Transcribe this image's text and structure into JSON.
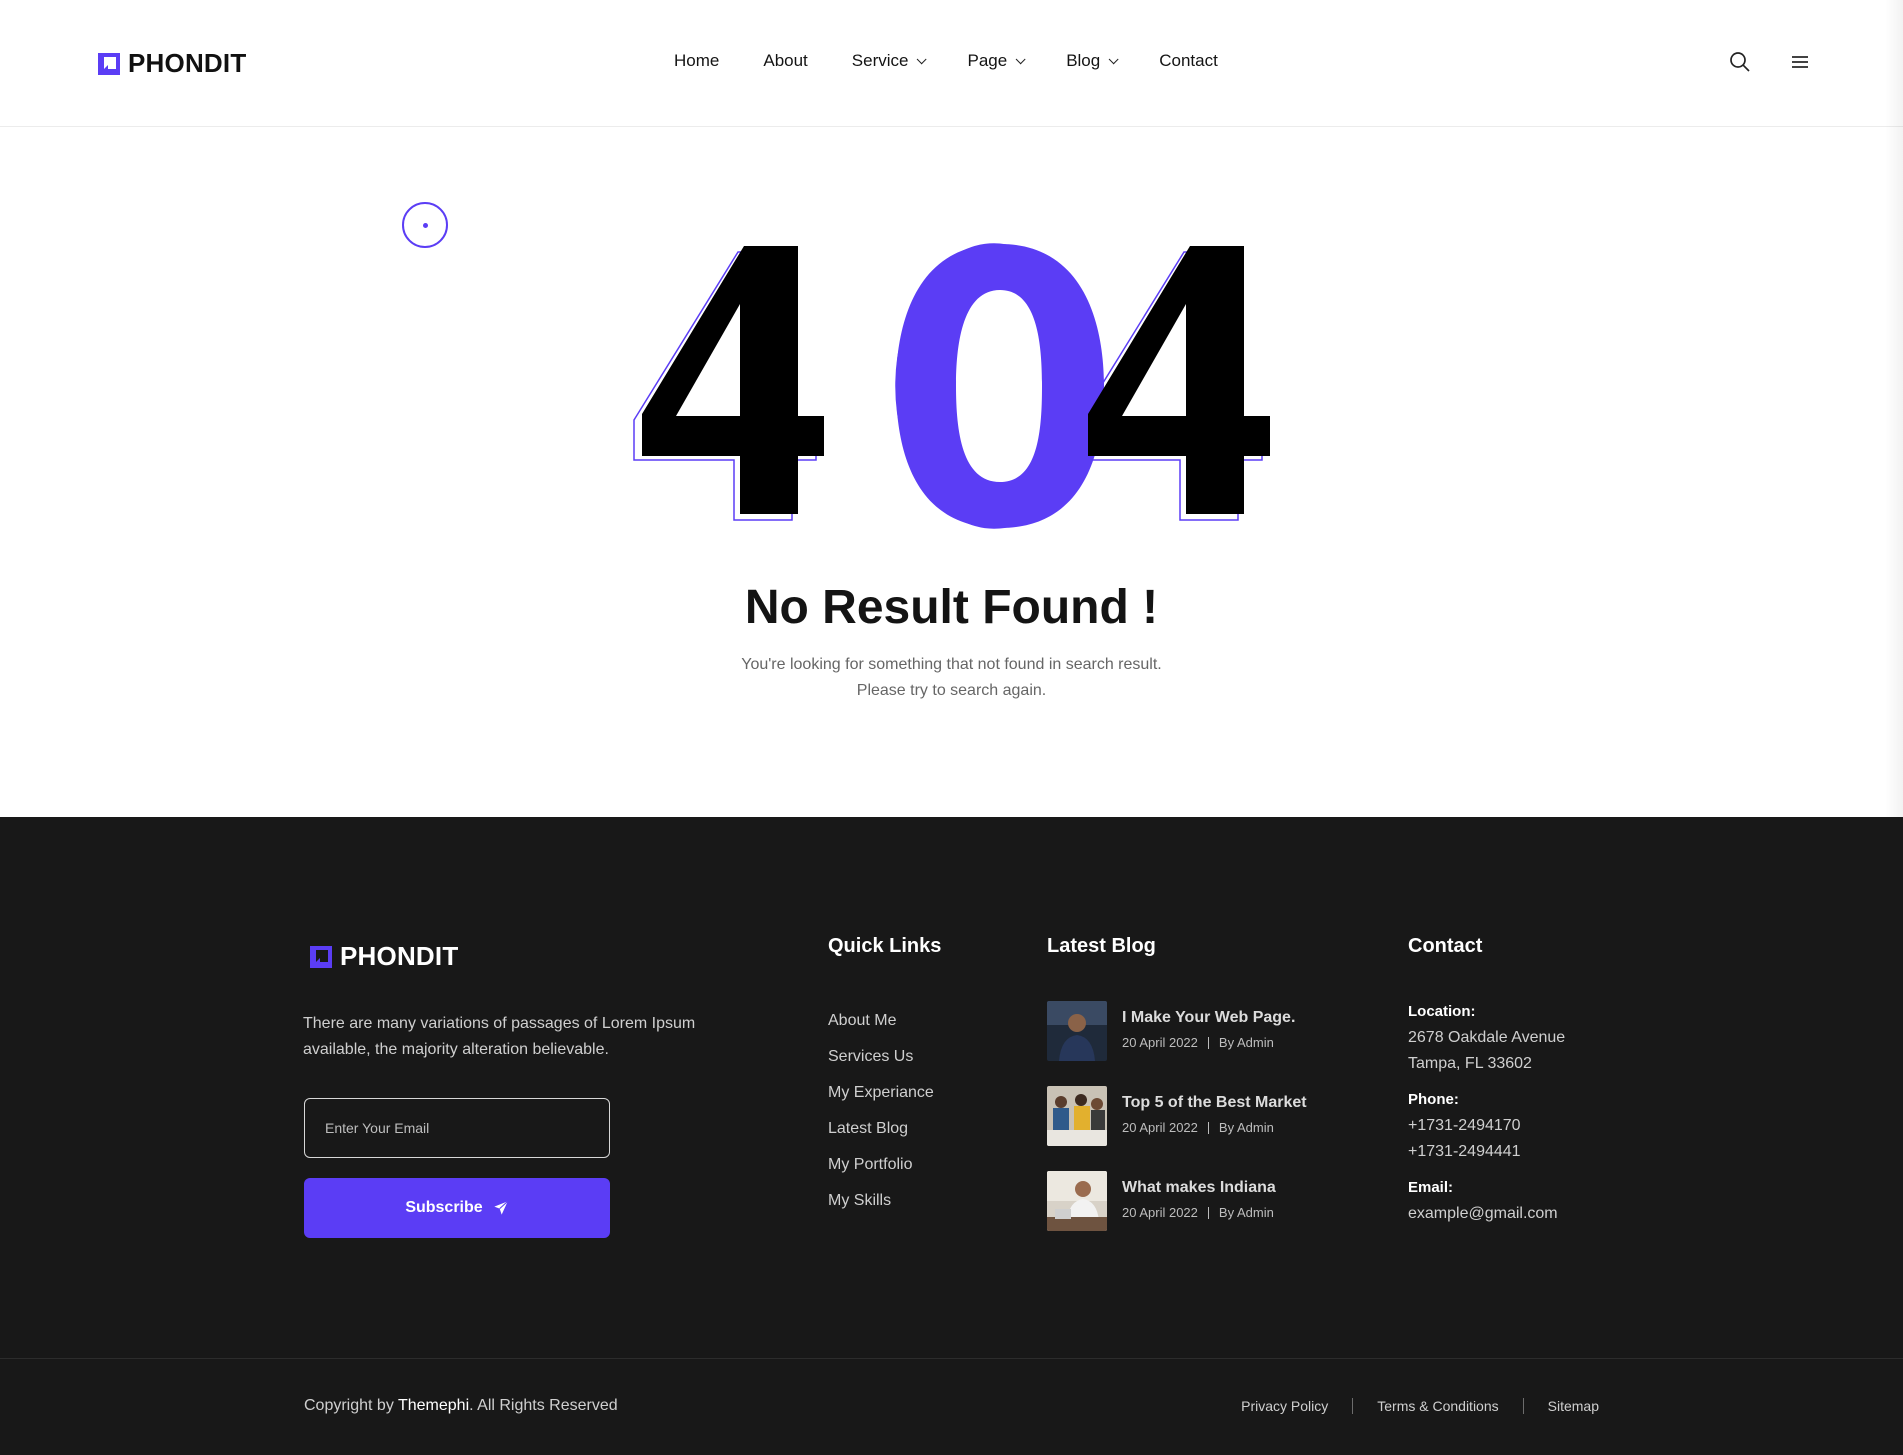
{
  "brand": {
    "name": "PHONDIT",
    "accent": "#5b3df5"
  },
  "nav": {
    "items": [
      {
        "label": "Home",
        "dropdown": false
      },
      {
        "label": "About",
        "dropdown": false
      },
      {
        "label": "Service",
        "dropdown": true
      },
      {
        "label": "Page",
        "dropdown": true
      },
      {
        "label": "Blog",
        "dropdown": true
      },
      {
        "label": "Contact",
        "dropdown": false
      }
    ],
    "icons": [
      "search-icon",
      "menu-icon"
    ]
  },
  "hero": {
    "code": "404",
    "title": "No Result Found !",
    "desc_line1": "You're looking for something that not found in search result.",
    "desc_line2": "Please try to search again."
  },
  "footer": {
    "brand": "PHONDIT",
    "about": "There are many variations of passages of Lorem Ipsum available, the majority alteration believable.",
    "email_placeholder": "Enter Your Email",
    "subscribe_label": "Subscribe",
    "quick_links_title": "Quick Links",
    "quick_links": [
      "About Me",
      "Services Us",
      "My Experiance",
      "Latest Blog",
      "My Portfolio",
      "My Skills"
    ],
    "blog_title": "Latest Blog",
    "blog_posts": [
      {
        "title": "I Make Your Web Page.",
        "date": "20 April 2022",
        "author": "By Admin"
      },
      {
        "title": "Top 5 of the Best Market",
        "date": "20 April 2022",
        "author": "By Admin"
      },
      {
        "title": "What makes Indiana",
        "date": "20 April 2022",
        "author": "By Admin"
      }
    ],
    "contact_title": "Contact",
    "contact": {
      "location_label": "Location:",
      "location_line1": "2678 Oakdale Avenue",
      "location_line2": "Tampa, FL 33602",
      "phone_label": "Phone:",
      "phone1": "+1731-2494170",
      "phone2": "+1731-2494441",
      "email_label": "Email:",
      "email": "example@gmail.com"
    },
    "copyright_prefix": "Copyright by ",
    "copyright_brand": "Themephi",
    "copyright_suffix": ". All Rights Reserved",
    "legal_links": [
      "Privacy Policy",
      "Terms & Conditions",
      "Sitemap"
    ]
  }
}
